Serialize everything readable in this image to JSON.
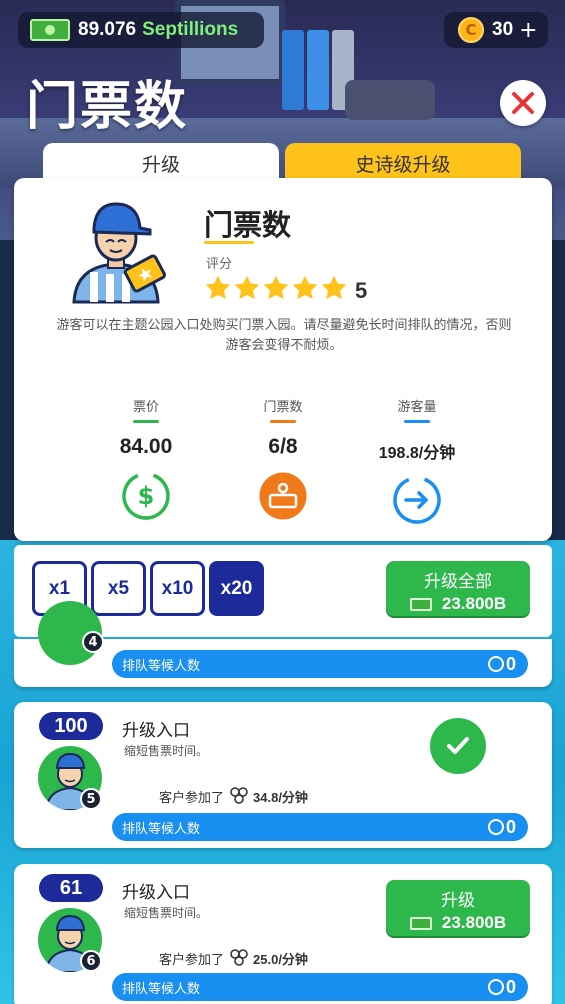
{
  "top_bar": {
    "cash_value": "89.076",
    "cash_unit": "Septillions",
    "coin_value": "30",
    "coin_plus": "+",
    "coin_symbol": "C"
  },
  "page_title": "门票数",
  "tabs": [
    {
      "label": "升级",
      "active": true
    },
    {
      "label": "史诗级升级",
      "active": false
    }
  ],
  "card": {
    "title": "门票数",
    "rating_label": "评分",
    "stars": 5,
    "rating_value": "5",
    "description": "游客可以在主题公园入口处购买门票入园。请尽量避免长时间排队的情况，否则游客会变得不耐烦。",
    "stats": [
      {
        "label": "票价",
        "value": "84.00",
        "icon": "dollar-icon",
        "color": "#2eb84c"
      },
      {
        "label": "门票数",
        "value": "6/8",
        "icon": "ticket-booth-icon",
        "color": "#f07a1a"
      },
      {
        "label": "游客量",
        "value": "198.8/分钟",
        "icon": "arrow-right-icon",
        "color": "#1a8ff2"
      }
    ]
  },
  "multipliers": {
    "options": [
      "x1",
      "x5",
      "x10",
      "x20"
    ],
    "selected": "x20",
    "upgrade_all_label": "升级全部",
    "upgrade_all_price": "23.800B"
  },
  "queue_label": "排队等候人数",
  "partial_card": {
    "queue_count": "0",
    "worker_count": "4"
  },
  "entrances": [
    {
      "level": "100",
      "title": "升级入口",
      "desc": "缩短售票时间。",
      "stat_prefix": "客户参加了",
      "stat_value": "34.8/分钟",
      "worker_count": "5",
      "queue_count": "0",
      "maxed": true
    },
    {
      "level": "61",
      "title": "升级入口",
      "desc": "缩短售票时间。",
      "stat_prefix": "客户参加了",
      "stat_value": "25.0/分钟",
      "worker_count": "6",
      "queue_count": "0",
      "maxed": false,
      "button_label": "升级",
      "button_price": "23.800B"
    }
  ],
  "colors": {
    "accent_blue": "#1d2b9a",
    "green": "#2eb84c",
    "yellow_tab": "#ffc21a",
    "queue_blue": "#1a8ff2",
    "close_red": "#e8333a"
  }
}
